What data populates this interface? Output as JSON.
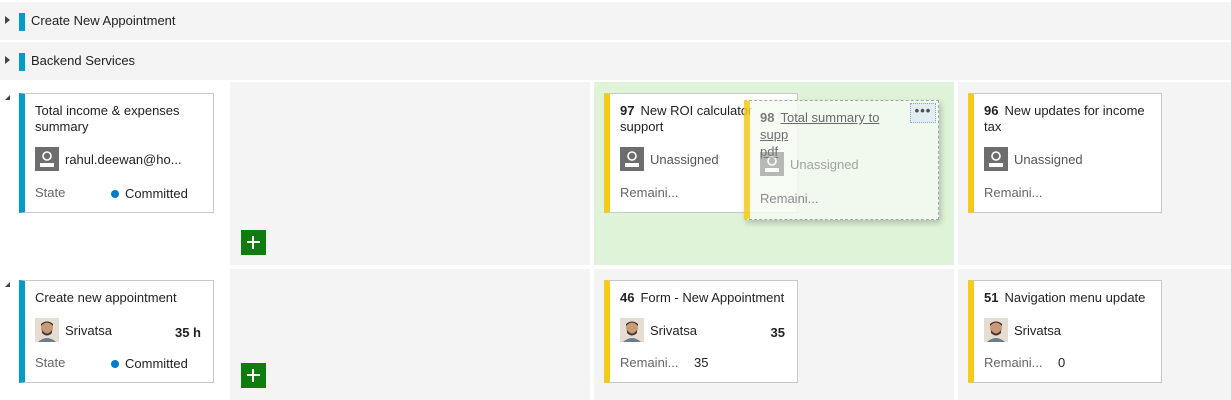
{
  "groups": [
    {
      "title": "Create New Appointment"
    },
    {
      "title": "Backend Services"
    }
  ],
  "rows": [
    {
      "parent": {
        "title": "Total income & expenses summary",
        "assignee": "rahul.deewan@ho...",
        "state_label": "State",
        "state_value": "Committed"
      },
      "cards": [
        {
          "id": "97",
          "title": "New ROI calculator support",
          "assignee": "Unassigned",
          "remaining_label": "Remaini...",
          "remaining_value": ""
        },
        {
          "id": "96",
          "title": "New updates for income tax",
          "assignee": "Unassigned",
          "remaining_label": "Remaini...",
          "remaining_value": ""
        }
      ],
      "dragging": {
        "id": "98",
        "title": "Total summary to supp",
        "title_wrap": "pdf",
        "assignee": "Unassigned",
        "remaining_label": "Remaini...",
        "more": "•••"
      }
    },
    {
      "parent": {
        "title": "Create new appointment",
        "assignee": "Srivatsa",
        "hours": "35 h",
        "state_label": "State",
        "state_value": "Committed"
      },
      "cards": [
        {
          "id": "46",
          "title": "Form - New Appointment",
          "assignee": "Srivatsa",
          "hours": "35",
          "remaining_label": "Remaini...",
          "remaining_value": "35"
        },
        {
          "id": "51",
          "title": "Navigation menu update",
          "assignee": "Srivatsa",
          "hours": "",
          "remaining_label": "Remaini...",
          "remaining_value": "0"
        }
      ]
    }
  ],
  "colors": {
    "blue": "#009ccc",
    "yellow": "#f2cb1d",
    "green_add": "#107c10",
    "drop_highlight": "#dff3d9"
  }
}
